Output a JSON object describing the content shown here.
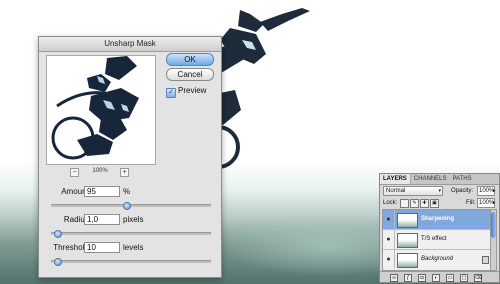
{
  "dialog": {
    "title": "Unsharp Mask",
    "ok_label": "OK",
    "cancel_label": "Cancel",
    "preview_label": "Preview",
    "preview_checked": true,
    "zoom_level": "100%",
    "zoom_minus": "−",
    "zoom_plus": "+",
    "amount": {
      "label": "Amount:",
      "value": "95",
      "unit": "%",
      "slider_fraction": 0.47
    },
    "radius": {
      "label": "Radius:",
      "value": "1,0",
      "unit": "pixels",
      "slider_fraction": 0.04
    },
    "threshold": {
      "label": "Threshold:",
      "value": "10",
      "unit": "levels",
      "slider_fraction": 0.04
    }
  },
  "layers_panel": {
    "tabs": [
      "LAYERS",
      "CHANNELS",
      "PATHS"
    ],
    "blend_mode": "Normal",
    "opacity_label": "Opacity:",
    "opacity_value": "100%",
    "lock_label": "Lock:",
    "fill_label": "Fill:",
    "fill_value": "100%",
    "layers": [
      {
        "name": "Sharpening",
        "selected": true
      },
      {
        "name": "T/S effect",
        "selected": false
      },
      {
        "name": "Background",
        "selected": false,
        "locked": true
      }
    ]
  },
  "colors": {
    "selection": "#7fa9dc",
    "ok_button": "#6ea9e6",
    "slider_thumb": "#5d92cf"
  },
  "icons": [
    "eye-icon",
    "lock-icon",
    "link-icon",
    "fx-icon",
    "mask-icon",
    "adjustment-icon",
    "folder-icon",
    "new-layer-icon",
    "trash-icon",
    "checkmark-icon"
  ]
}
